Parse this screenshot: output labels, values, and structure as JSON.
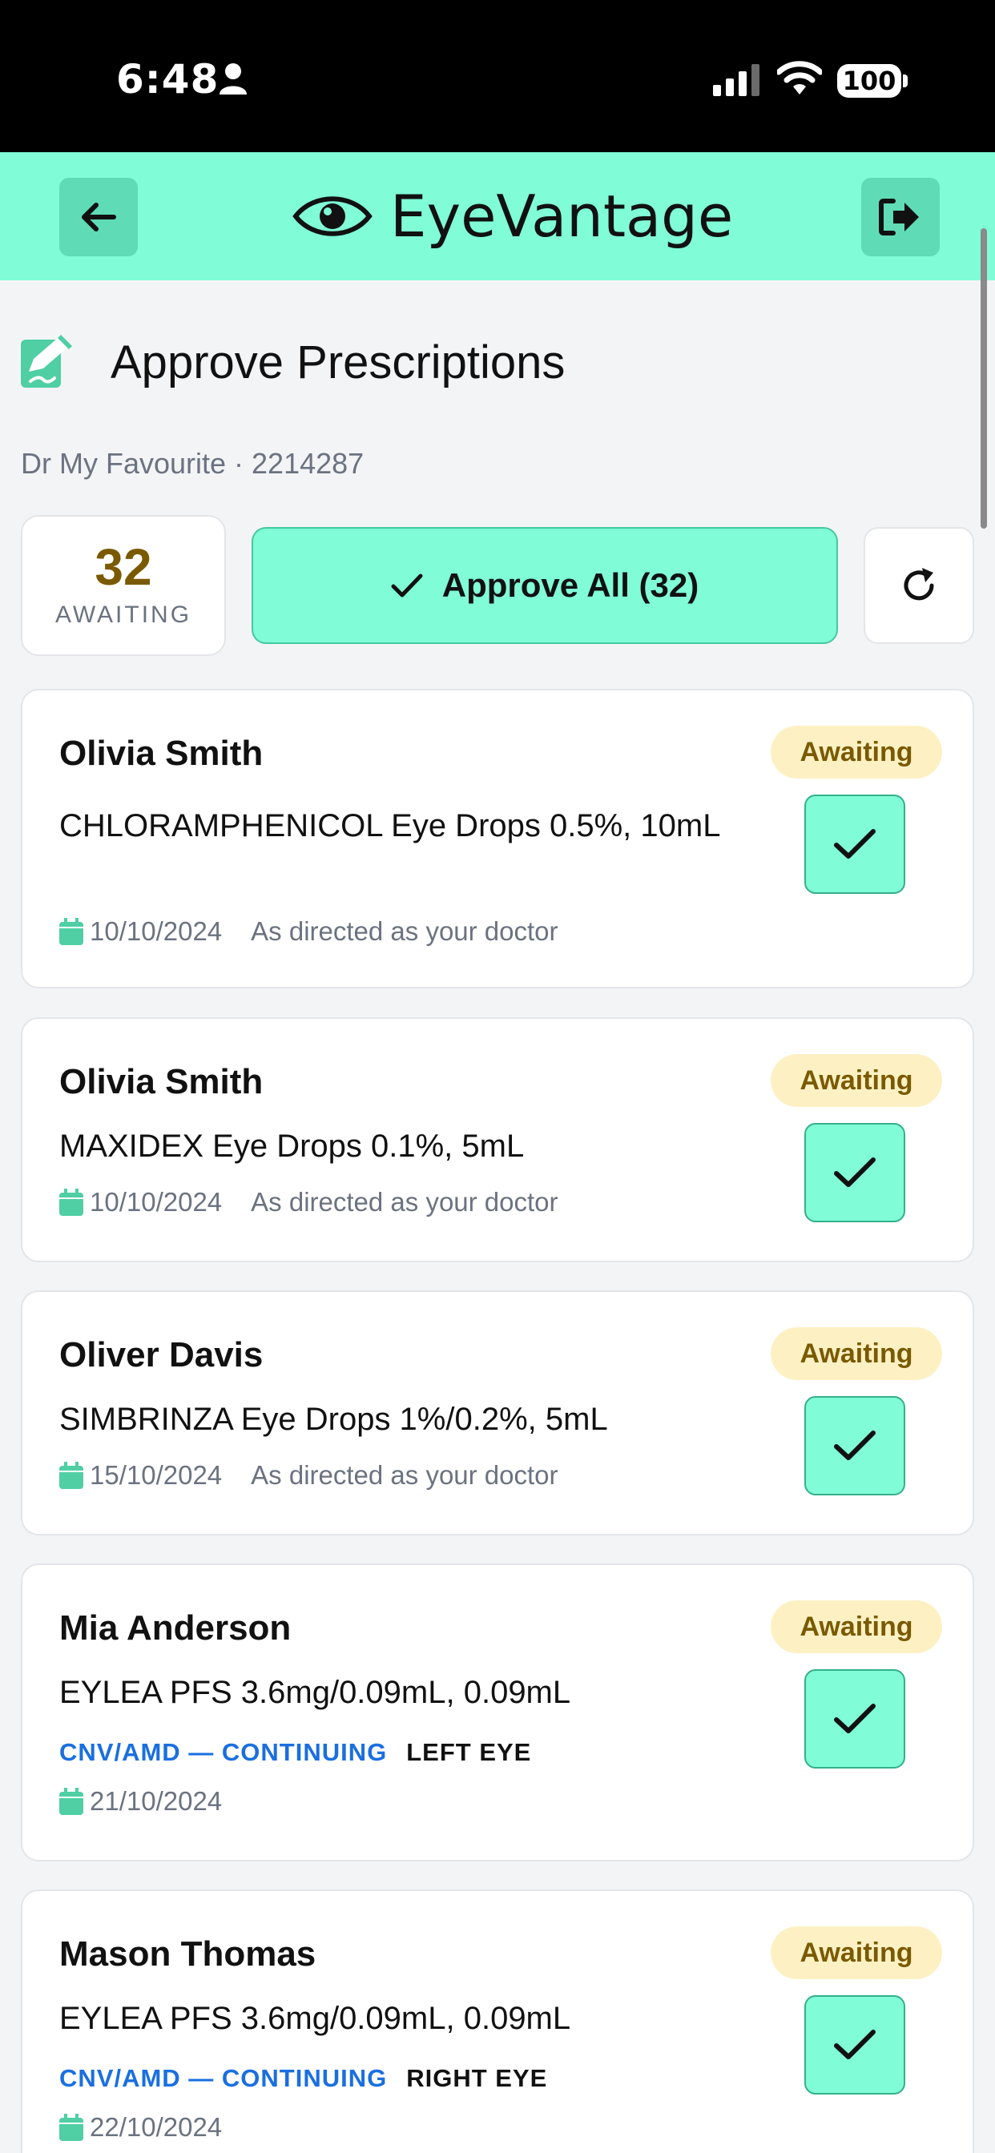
{
  "status_bar": {
    "time": "6:48",
    "battery": "100"
  },
  "header": {
    "app_name": "EyeVantage"
  },
  "page": {
    "title": "Approve Prescriptions",
    "doctor_line": "Dr My Favourite · 2214287"
  },
  "summary": {
    "count": "32",
    "count_label": "AWAITING",
    "approve_all_label": "Approve All (32)"
  },
  "prescriptions": [
    {
      "patient": "Olivia Smith",
      "medication": "CHLORAMPHENICOL Eye Drops 0.5%, 10mL",
      "date": "10/10/2024",
      "directions": "As directed as your doctor",
      "status": "Awaiting"
    },
    {
      "patient": "Olivia Smith",
      "medication": "MAXIDEX Eye Drops 0.1%, 5mL",
      "date": "10/10/2024",
      "directions": "As directed as your doctor",
      "status": "Awaiting"
    },
    {
      "patient": "Oliver Davis",
      "medication": "SIMBRINZA Eye Drops 1%/0.2%, 5mL",
      "date": "15/10/2024",
      "directions": "As directed as your doctor",
      "status": "Awaiting"
    },
    {
      "patient": "Mia Anderson",
      "medication": "EYLEA PFS 3.6mg/0.09mL, 0.09mL",
      "condition": "CNV/AMD — CONTINUING",
      "eye": "LEFT EYE",
      "date": "21/10/2024",
      "status": "Awaiting"
    },
    {
      "patient": "Mason Thomas",
      "medication": "EYLEA PFS 3.6mg/0.09mL, 0.09mL",
      "condition": "CNV/AMD — CONTINUING",
      "eye": "RIGHT EYE",
      "date": "22/10/2024",
      "status": "Awaiting"
    }
  ],
  "colors": {
    "accent": "#80fcd7",
    "badge_bg": "#fdf1c4",
    "badge_text": "#7a5a00",
    "condition_text": "#1a6fe0"
  },
  "icons": [
    "person-icon",
    "signal-icon",
    "wifi-icon",
    "back-arrow-icon",
    "eye-logo-icon",
    "logout-icon",
    "edit-document-icon",
    "check-icon",
    "refresh-icon",
    "calendar-icon"
  ]
}
